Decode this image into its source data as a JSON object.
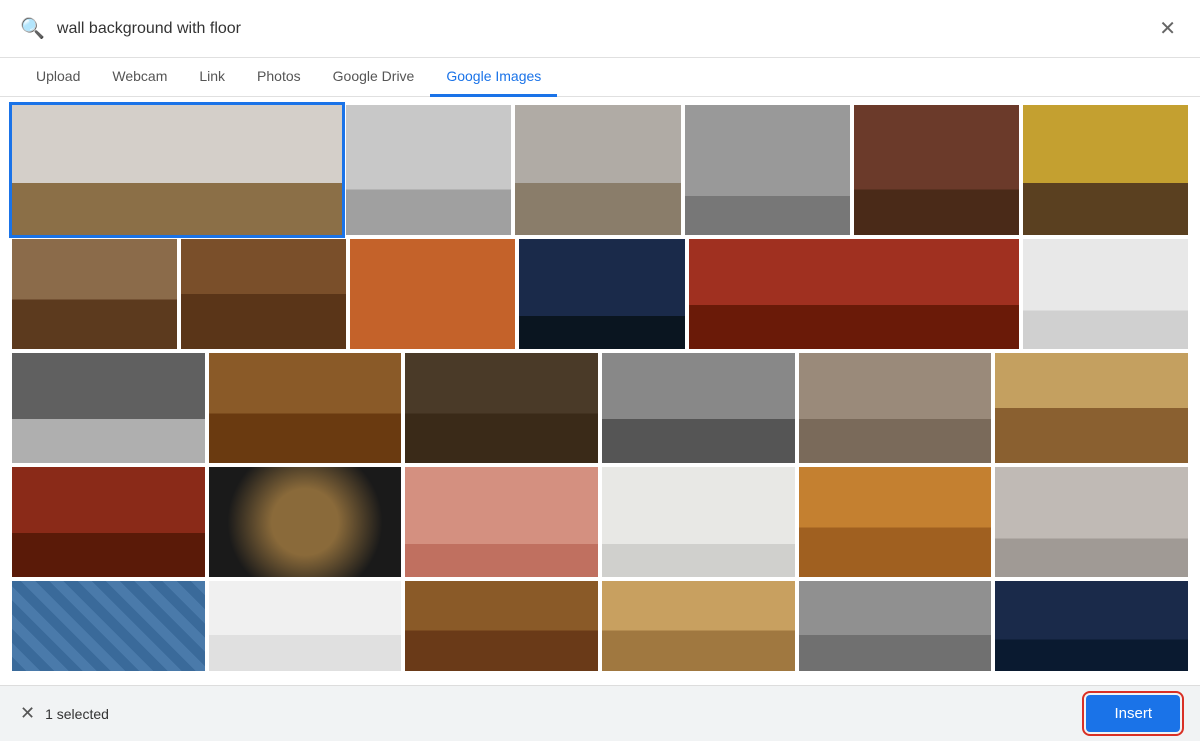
{
  "search": {
    "placeholder": "wall background with floor",
    "value": "wall background with floor"
  },
  "tabs": [
    {
      "id": "upload",
      "label": "Upload",
      "active": false
    },
    {
      "id": "webcam",
      "label": "Webcam",
      "active": false
    },
    {
      "id": "link",
      "label": "Link",
      "active": false
    },
    {
      "id": "photos",
      "label": "Photos",
      "active": false
    },
    {
      "id": "google_drive",
      "label": "Google Drive",
      "active": false
    },
    {
      "id": "google_images",
      "label": "Google Images",
      "active": true
    }
  ],
  "bottom_bar": {
    "selected_count": "1 selected",
    "insert_label": "Insert"
  },
  "images": {
    "rows": [
      [
        {
          "id": "img1",
          "selected": true,
          "color_class": "img-white-brick",
          "wide": true
        },
        {
          "id": "img2",
          "selected": false,
          "color_class": "img-gray-fog"
        },
        {
          "id": "img3",
          "selected": false,
          "color_class": "img-gray-concrete"
        },
        {
          "id": "img4",
          "selected": false,
          "color_class": "img-gray-wall"
        },
        {
          "id": "img5",
          "selected": false,
          "color_class": "img-red-brick-dark"
        },
        {
          "id": "img6",
          "selected": false,
          "color_class": "img-yellow-peeling"
        }
      ],
      [
        {
          "id": "img7",
          "selected": false,
          "color_class": "img-brown-brick"
        },
        {
          "id": "img8",
          "selected": false,
          "color_class": "img-wood-panel"
        },
        {
          "id": "img9",
          "selected": false,
          "color_class": "img-orange-brick"
        },
        {
          "id": "img10",
          "selected": false,
          "color_class": "img-dark-navy"
        },
        {
          "id": "img11",
          "selected": false,
          "color_class": "img-red-brick-wide",
          "wide": true
        },
        {
          "id": "img12",
          "selected": false,
          "color_class": "img-white-clean"
        }
      ],
      [
        {
          "id": "img13",
          "selected": false,
          "color_class": "img-gray-stone"
        },
        {
          "id": "img14",
          "selected": false,
          "color_class": "img-wood-warm"
        },
        {
          "id": "img15",
          "selected": false,
          "color_class": "img-dark-wood"
        },
        {
          "id": "img16",
          "selected": false,
          "color_class": "img-gray-planks"
        },
        {
          "id": "img17",
          "selected": false,
          "color_class": "img-old-wood"
        },
        {
          "id": "img18",
          "selected": false,
          "color_class": "img-stacked-wood"
        }
      ],
      [
        {
          "id": "img19",
          "selected": false,
          "color_class": "img-red-brick2"
        },
        {
          "id": "img20",
          "selected": false,
          "color_class": "img-dark-spot"
        },
        {
          "id": "img21",
          "selected": false,
          "color_class": "img-pink-wall"
        },
        {
          "id": "img22",
          "selected": false,
          "color_class": "img-white-plaster"
        },
        {
          "id": "img23",
          "selected": false,
          "color_class": "img-pine-wood"
        },
        {
          "id": "img24",
          "selected": false,
          "color_class": "img-gray-concrete2"
        }
      ],
      [
        {
          "id": "img25",
          "selected": false,
          "color_class": "img-blue-tile"
        },
        {
          "id": "img26",
          "selected": false,
          "color_class": "img-white-table"
        },
        {
          "id": "img27",
          "selected": false,
          "color_class": "img-brown-planks"
        },
        {
          "id": "img28",
          "selected": false,
          "color_class": "img-light-wood"
        },
        {
          "id": "img29",
          "selected": false,
          "color_class": "img-gray-planks2"
        },
        {
          "id": "img30",
          "selected": false,
          "color_class": "img-navy-wall"
        }
      ]
    ]
  }
}
